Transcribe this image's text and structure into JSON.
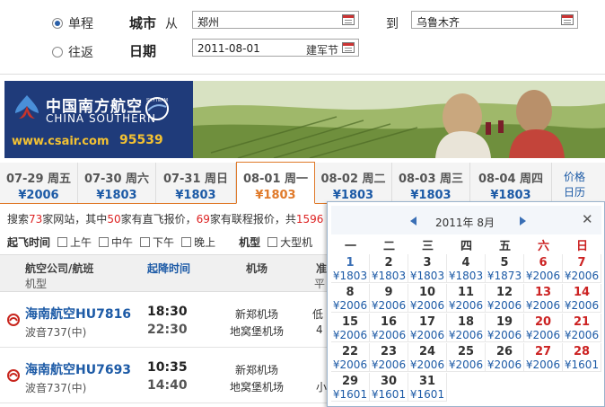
{
  "search": {
    "oneway_label": "单程",
    "roundtrip_label": "往返",
    "city_label": "城市",
    "from_label": "从",
    "to_label": "到",
    "from_city": "郑州",
    "to_city": "乌鲁木齐",
    "date_label": "日期",
    "date_value": "2011-08-01",
    "holiday": "建军节"
  },
  "banner": {
    "logo_cn": "中国南方航空",
    "logo_en": "CHINA SOUTHERN",
    "skyteam": "SKYTEAM",
    "site": "www.csair.com",
    "phone": "95539",
    "brand_color": "#1f3b7a"
  },
  "date_tabs": [
    {
      "date": "07-29 周五",
      "price": "¥2006"
    },
    {
      "date": "07-30 周六",
      "price": "¥1803"
    },
    {
      "date": "07-31 周日",
      "price": "¥1803"
    },
    {
      "date": "08-01 周一",
      "price": "¥1803",
      "active": true
    },
    {
      "date": "08-02 周二",
      "price": "¥1803"
    },
    {
      "date": "08-03 周三",
      "price": "¥1803"
    },
    {
      "date": "08-04 周四",
      "price": "¥1803"
    }
  ],
  "price_calendar": {
    "line1": "价格",
    "line2": "日历"
  },
  "info": {
    "p1": "搜索",
    "sites": "73",
    "p2": "家网站，其中",
    "direct": "50",
    "p3": "家有直飞报价，",
    "connect": "69",
    "p4": "家有联程报价，共",
    "total": "1596"
  },
  "filters": {
    "time_title": "起飞时间",
    "times": [
      "上午",
      "中午",
      "下午",
      "晚上"
    ],
    "type_title": "机型",
    "types": [
      "大型机"
    ]
  },
  "table": {
    "col_airline": "航空公司/航班",
    "col_plane": "机型",
    "col_time": "起降时间",
    "col_airport": "机场",
    "col_more": "准",
    "col_more2": "平"
  },
  "flights": [
    {
      "airline_flight": "海南航空HU7816",
      "plane": "波音737(中)",
      "dep": "18:30",
      "arr": "22:30",
      "dep_airport": "新郑机场",
      "arr_airport": "地窝堡机场",
      "extra1": "低",
      "extra2": "4"
    },
    {
      "airline_flight": "海南航空HU7693",
      "plane": "波音737(中)",
      "dep": "10:35",
      "arr": "14:40",
      "dep_airport": "新郑机场",
      "arr_airport": "地窝堡机场",
      "extra1": "",
      "extra2": "小"
    }
  ],
  "calendar": {
    "month_title": "2011年 8月",
    "weekdays": [
      "一",
      "二",
      "三",
      "四",
      "五",
      "六",
      "日"
    ],
    "weeks": [
      [
        {
          "d": "1",
          "p": "¥1803",
          "today": true
        },
        {
          "d": "2",
          "p": "¥1803"
        },
        {
          "d": "3",
          "p": "¥1803"
        },
        {
          "d": "4",
          "p": "¥1803"
        },
        {
          "d": "5",
          "p": "¥1873"
        },
        {
          "d": "6",
          "p": "¥2006"
        },
        {
          "d": "7",
          "p": "¥2006"
        }
      ],
      [
        {
          "d": "8",
          "p": "¥2006"
        },
        {
          "d": "9",
          "p": "¥2006"
        },
        {
          "d": "10",
          "p": "¥2006"
        },
        {
          "d": "11",
          "p": "¥2006"
        },
        {
          "d": "12",
          "p": "¥2006"
        },
        {
          "d": "13",
          "p": "¥2006"
        },
        {
          "d": "14",
          "p": "¥2006"
        }
      ],
      [
        {
          "d": "15",
          "p": "¥2006"
        },
        {
          "d": "16",
          "p": "¥2006"
        },
        {
          "d": "17",
          "p": "¥2006"
        },
        {
          "d": "18",
          "p": "¥2006"
        },
        {
          "d": "19",
          "p": "¥2006"
        },
        {
          "d": "20",
          "p": "¥2006"
        },
        {
          "d": "21",
          "p": "¥2006"
        }
      ],
      [
        {
          "d": "22",
          "p": "¥2006"
        },
        {
          "d": "23",
          "p": "¥2006"
        },
        {
          "d": "24",
          "p": "¥2006"
        },
        {
          "d": "25",
          "p": "¥2006"
        },
        {
          "d": "26",
          "p": "¥2006"
        },
        {
          "d": "27",
          "p": "¥2006"
        },
        {
          "d": "28",
          "p": "¥1601"
        }
      ],
      [
        {
          "d": "29",
          "p": "¥1601"
        },
        {
          "d": "30",
          "p": "¥1601"
        },
        {
          "d": "31",
          "p": "¥1601"
        }
      ]
    ]
  }
}
